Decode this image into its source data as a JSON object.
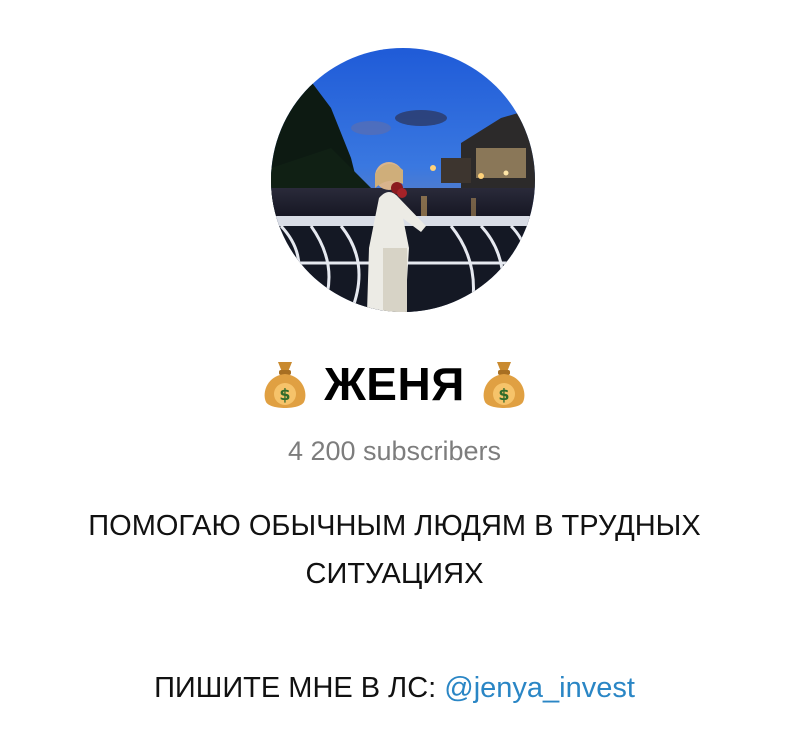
{
  "channel": {
    "name": "ЖЕНЯ",
    "title_icon": "money-bag-icon",
    "subscribers": "4 200 subscribers",
    "bio": {
      "line1": "ПОМОГАЮ ОБЫЧНЫМ ЛЮДЯМ В ТРУДНЫХ",
      "line2": "СИТУАЦИЯХ"
    },
    "contact": {
      "prefix": "ПИШИТЕ МНЕ В ЛС:",
      "handle": "@jenya_invest"
    }
  },
  "colors": {
    "link": "#2a86c5",
    "muted": "#7d7d7d",
    "bag": "#e0a042"
  }
}
